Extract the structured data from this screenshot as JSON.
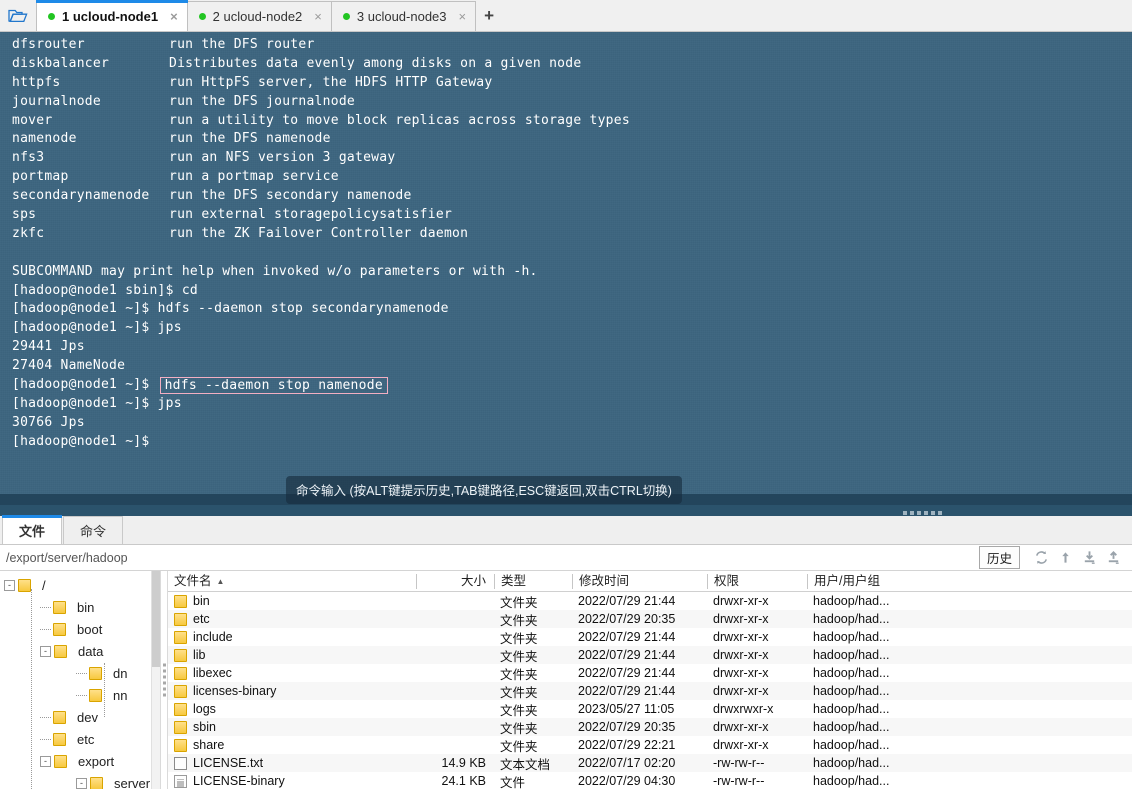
{
  "titlebar": {
    "folder_icon": "open-folder-icon",
    "add_tab_label": "+",
    "tabs": [
      {
        "label": "1 ucloud-node1",
        "close": "×",
        "active": true
      },
      {
        "label": "2 ucloud-node2",
        "close": "×",
        "active": false
      },
      {
        "label": "3 ucloud-node3",
        "close": "×",
        "active": false
      }
    ]
  },
  "terminal": {
    "hint": "命令输入 (按ALT键提示历史,TAB键路径,ESC键返回,双击CTRL切换)",
    "help_rows": [
      {
        "cmd": "dfsrouter",
        "desc": "run the DFS router"
      },
      {
        "cmd": "diskbalancer",
        "desc": "Distributes data evenly among disks on a given node"
      },
      {
        "cmd": "httpfs",
        "desc": "run HttpFS server, the HDFS HTTP Gateway"
      },
      {
        "cmd": "journalnode",
        "desc": "run the DFS journalnode"
      },
      {
        "cmd": "mover",
        "desc": "run a utility to move block replicas across storage types"
      },
      {
        "cmd": "namenode",
        "desc": "run the DFS namenode"
      },
      {
        "cmd": "nfs3",
        "desc": "run an NFS version 3 gateway"
      },
      {
        "cmd": "portmap",
        "desc": "run a portmap service"
      },
      {
        "cmd": "secondarynamenode",
        "desc": "run the DFS secondary namenode"
      },
      {
        "cmd": "sps",
        "desc": "run external storagepolicysatisfier"
      },
      {
        "cmd": "zkfc",
        "desc": "run the ZK Failover Controller daemon"
      }
    ],
    "note": "SUBCOMMAND may print help when invoked w/o parameters or with -h.",
    "session": [
      {
        "prompt": "[hadoop@node1 sbin]$ ",
        "text": "cd"
      },
      {
        "prompt": "[hadoop@node1 ~]$ ",
        "text": "hdfs --daemon stop secondarynamenode"
      },
      {
        "prompt": "[hadoop@node1 ~]$ ",
        "text": "jps"
      },
      {
        "prompt": "",
        "text": "29441 Jps"
      },
      {
        "prompt": "",
        "text": "27404 NameNode"
      },
      {
        "prompt": "[hadoop@node1 ~]$ ",
        "text": "hdfs --daemon stop namenode",
        "highlight": true
      },
      {
        "prompt": "[hadoop@node1 ~]$ ",
        "text": "jps"
      },
      {
        "prompt": "",
        "text": "30766 Jps"
      },
      {
        "prompt": "[hadoop@node1 ~]$ ",
        "text": ""
      }
    ]
  },
  "panel": {
    "tabs": [
      {
        "label": "文件",
        "active": true
      },
      {
        "label": "命令",
        "active": false
      }
    ],
    "path": "/export/server/hadoop",
    "history_button": "历史",
    "toolbar_icons": [
      "refresh-icon",
      "up-arrow-icon",
      "download-icon",
      "upload-icon"
    ],
    "tree": [
      {
        "label": "/",
        "depth": 0,
        "expander": "-",
        "icon": "folder-icon"
      },
      {
        "label": "bin",
        "depth": 1,
        "expander": "",
        "icon": "folder-icon"
      },
      {
        "label": "boot",
        "depth": 1,
        "expander": "",
        "icon": "folder-icon"
      },
      {
        "label": "data",
        "depth": 1,
        "expander": "-",
        "icon": "folder-icon"
      },
      {
        "label": "dn",
        "depth": 2,
        "expander": "",
        "icon": "folder-icon"
      },
      {
        "label": "nn",
        "depth": 2,
        "expander": "",
        "icon": "folder-icon"
      },
      {
        "label": "dev",
        "depth": 1,
        "expander": "",
        "icon": "folder-icon"
      },
      {
        "label": "etc",
        "depth": 1,
        "expander": "",
        "icon": "folder-icon"
      },
      {
        "label": "export",
        "depth": 1,
        "expander": "-",
        "icon": "folder-icon"
      },
      {
        "label": "server",
        "depth": 2,
        "expander": "-",
        "icon": "folder-icon"
      }
    ],
    "columns": {
      "name": "文件名",
      "size": "大小",
      "type": "类型",
      "mtime": "修改时间",
      "perm": "权限",
      "owner": "用户/用户组",
      "sort_arrow": "▲"
    },
    "files": [
      {
        "name": "bin",
        "size": "",
        "type": "文件夹",
        "mtime": "2022/07/29 21:44",
        "perm": "drwxr-xr-x",
        "owner": "hadoop/had...",
        "icon": "folder-icon"
      },
      {
        "name": "etc",
        "size": "",
        "type": "文件夹",
        "mtime": "2022/07/29 20:35",
        "perm": "drwxr-xr-x",
        "owner": "hadoop/had...",
        "icon": "folder-icon"
      },
      {
        "name": "include",
        "size": "",
        "type": "文件夹",
        "mtime": "2022/07/29 21:44",
        "perm": "drwxr-xr-x",
        "owner": "hadoop/had...",
        "icon": "folder-icon"
      },
      {
        "name": "lib",
        "size": "",
        "type": "文件夹",
        "mtime": "2022/07/29 21:44",
        "perm": "drwxr-xr-x",
        "owner": "hadoop/had...",
        "icon": "folder-icon"
      },
      {
        "name": "libexec",
        "size": "",
        "type": "文件夹",
        "mtime": "2022/07/29 21:44",
        "perm": "drwxr-xr-x",
        "owner": "hadoop/had...",
        "icon": "folder-icon"
      },
      {
        "name": "licenses-binary",
        "size": "",
        "type": "文件夹",
        "mtime": "2022/07/29 21:44",
        "perm": "drwxr-xr-x",
        "owner": "hadoop/had...",
        "icon": "folder-icon"
      },
      {
        "name": "logs",
        "size": "",
        "type": "文件夹",
        "mtime": "2023/05/27 11:05",
        "perm": "drwxrwxr-x",
        "owner": "hadoop/had...",
        "icon": "folder-icon"
      },
      {
        "name": "sbin",
        "size": "",
        "type": "文件夹",
        "mtime": "2022/07/29 20:35",
        "perm": "drwxr-xr-x",
        "owner": "hadoop/had...",
        "icon": "folder-icon"
      },
      {
        "name": "share",
        "size": "",
        "type": "文件夹",
        "mtime": "2022/07/29 22:21",
        "perm": "drwxr-xr-x",
        "owner": "hadoop/had...",
        "icon": "folder-icon"
      },
      {
        "name": "LICENSE.txt",
        "size": "14.9 KB",
        "type": "文本文档",
        "mtime": "2022/07/17 02:20",
        "perm": "-rw-rw-r--",
        "owner": "hadoop/had...",
        "icon": "text-file-icon"
      },
      {
        "name": "LICENSE-binary",
        "size": "24.1 KB",
        "type": "文件",
        "mtime": "2022/07/29 04:30",
        "perm": "-rw-rw-r--",
        "owner": "hadoop/had...",
        "icon": "file-icon"
      }
    ]
  },
  "colors": {
    "terminal_bg": "#3d657f",
    "accent": "#1e8ae8",
    "tab_dot": "#22c522",
    "highlight_border": "#f3afc3",
    "folder_yellow": "#f7c93f"
  }
}
